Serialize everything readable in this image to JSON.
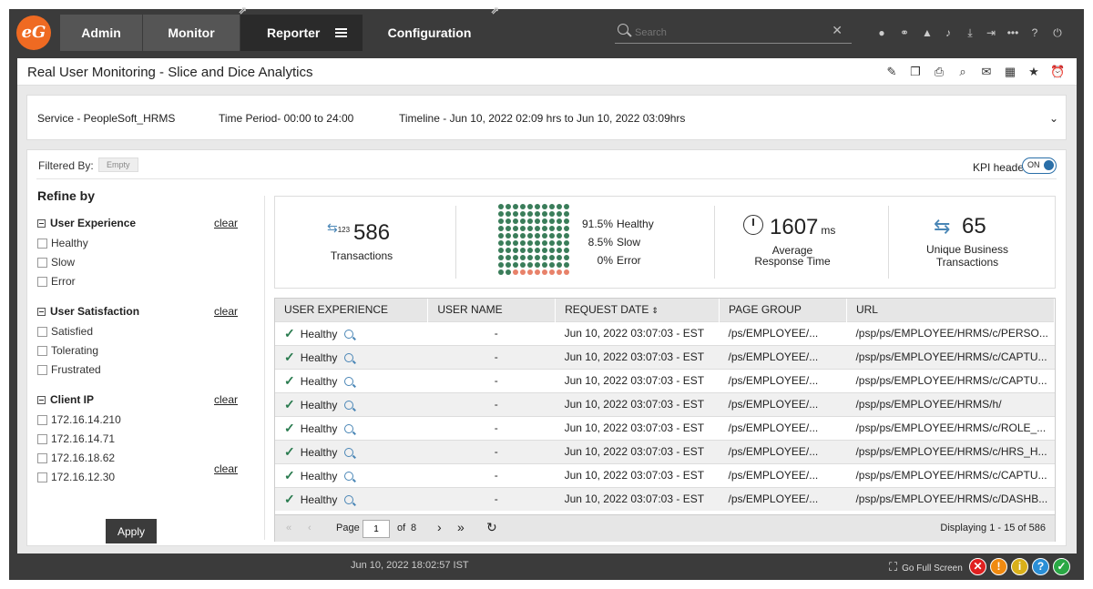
{
  "nav": {
    "tabs": [
      "Admin",
      "Monitor",
      "Reporter",
      "Configuration"
    ],
    "search_placeholder": "Search",
    "icons": [
      "user-icon",
      "link-icon",
      "report-icon",
      "bell-icon",
      "download-icon",
      "signin-icon",
      "more-icon",
      "help-icon",
      "power-icon"
    ]
  },
  "page": {
    "title": "Real User Monitoring - Slice and Dice Analytics",
    "service": "Service - PeopleSoft_HRMS",
    "time_period": "Time Period- 00:00 to 24:00",
    "timeline": "Timeline - Jun 10, 2022 02:09 hrs to Jun 10, 2022 03:09hrs",
    "filtered_by_label": "Filtered By:",
    "filtered_by_value": "Empty",
    "kpi_header_label": "KPI header",
    "kpi_toggle": "ON"
  },
  "refine": {
    "title": "Refine by",
    "clear": "clear",
    "groups": [
      {
        "title": "User Experience",
        "options": [
          "Healthy",
          "Slow",
          "Error"
        ]
      },
      {
        "title": "User Satisfaction",
        "options": [
          "Satisfied",
          "Tolerating",
          "Frustrated"
        ]
      },
      {
        "title": "Client IP",
        "options": [
          "172.16.14.210",
          "172.16.14.71",
          "172.16.18.62",
          "172.16.12.30"
        ]
      }
    ],
    "apply": "Apply"
  },
  "kpi": {
    "transactions": {
      "icon_text": "123",
      "value": "586",
      "label": "Transactions"
    },
    "experience": [
      {
        "pct": "91.5%",
        "label": "Healthy",
        "color": "#3a7d5a"
      },
      {
        "pct": "8.5%",
        "label": "Slow",
        "color": "#e8826a"
      },
      {
        "pct": "0%",
        "label": "Error",
        "color": "#d9534f"
      }
    ],
    "response": {
      "value": "1607",
      "unit": "ms",
      "label1": "Average",
      "label2": "Response Time"
    },
    "unique": {
      "value": "65",
      "label1": "Unique Business",
      "label2": "Transactions"
    }
  },
  "table": {
    "columns": [
      "USER EXPERIENCE",
      "USER NAME",
      "REQUEST DATE",
      "PAGE GROUP",
      "URL"
    ],
    "rows": [
      {
        "exp": "Healthy",
        "user": "-",
        "date": "Jun 10, 2022 03:07:03 - EST",
        "group": "/ps/EMPLOYEE/...",
        "url": "/psp/ps/EMPLOYEE/HRMS/c/PERSO..."
      },
      {
        "exp": "Healthy",
        "user": "-",
        "date": "Jun 10, 2022 03:07:03 - EST",
        "group": "/ps/EMPLOYEE/...",
        "url": "/psp/ps/EMPLOYEE/HRMS/c/CAPTU..."
      },
      {
        "exp": "Healthy",
        "user": "-",
        "date": "Jun 10, 2022 03:07:03 - EST",
        "group": "/ps/EMPLOYEE/...",
        "url": "/psp/ps/EMPLOYEE/HRMS/c/CAPTU..."
      },
      {
        "exp": "Healthy",
        "user": "-",
        "date": "Jun 10, 2022 03:07:03 - EST",
        "group": "/ps/EMPLOYEE/...",
        "url": "/psp/ps/EMPLOYEE/HRMS/h/"
      },
      {
        "exp": "Healthy",
        "user": "-",
        "date": "Jun 10, 2022 03:07:03 - EST",
        "group": "/ps/EMPLOYEE/...",
        "url": "/psp/ps/EMPLOYEE/HRMS/c/ROLE_..."
      },
      {
        "exp": "Healthy",
        "user": "-",
        "date": "Jun 10, 2022 03:07:03 - EST",
        "group": "/ps/EMPLOYEE/...",
        "url": "/psp/ps/EMPLOYEE/HRMS/c/HRS_H..."
      },
      {
        "exp": "Healthy",
        "user": "-",
        "date": "Jun 10, 2022 03:07:03 - EST",
        "group": "/ps/EMPLOYEE/...",
        "url": "/psp/ps/EMPLOYEE/HRMS/c/CAPTU..."
      },
      {
        "exp": "Healthy",
        "user": "-",
        "date": "Jun 10, 2022 03:07:03 - EST",
        "group": "/ps/EMPLOYEE/...",
        "url": "/psp/ps/EMPLOYEE/HRMS/c/DASHB..."
      }
    ],
    "pager": {
      "page_label": "Page",
      "page": "1",
      "of": "of",
      "total_pages": "8",
      "displaying": "Displaying 1 - 15 of 586"
    }
  },
  "footer": {
    "time": "Jun 10, 2022 18:02:57 IST",
    "fullscreen": "Go Full Screen",
    "status": [
      {
        "glyph": "✕",
        "color": "#e02020",
        "name": "critical-status-icon"
      },
      {
        "glyph": "!",
        "color": "#f08a10",
        "name": "major-status-icon"
      },
      {
        "glyph": "i",
        "color": "#d9b01a",
        "name": "minor-status-icon"
      },
      {
        "glyph": "?",
        "color": "#2a8fd6",
        "name": "unknown-status-icon"
      },
      {
        "glyph": "✓",
        "color": "#2aa845",
        "name": "normal-status-icon"
      }
    ]
  }
}
